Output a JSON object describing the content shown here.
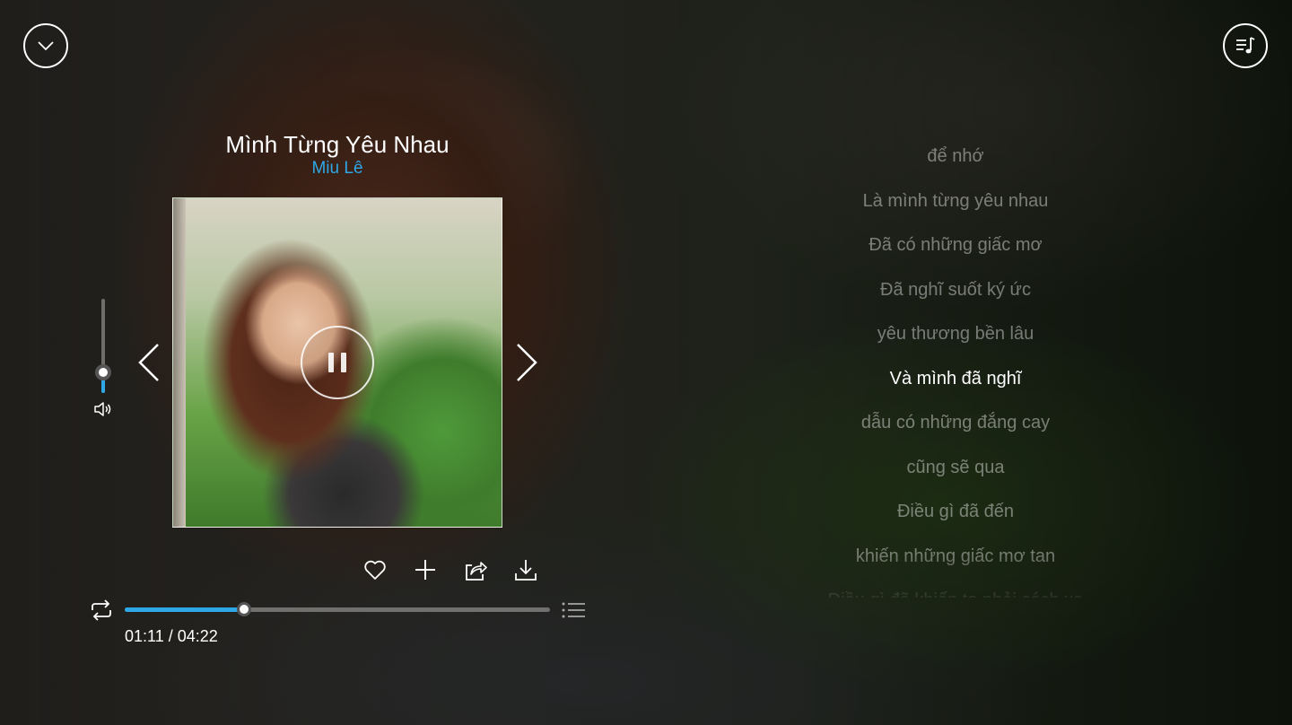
{
  "player": {
    "title": "Mình Từng Yêu Nhau",
    "artist": "Miu Lê",
    "time_display": "01:11 / 04:22",
    "progress": 0.28,
    "volume": 0.22,
    "state": "playing"
  },
  "icons": {
    "collapse": "chevron-down-icon",
    "playlist": "music-list-icon",
    "pause": "pause-icon",
    "prev": "chevron-left-icon",
    "next": "chevron-right-icon",
    "volume": "speaker-icon",
    "like": "heart-icon",
    "add": "plus-icon",
    "share": "share-icon",
    "download": "download-icon",
    "repeat": "repeat-icon",
    "queue": "queue-list-icon"
  },
  "colors": {
    "accent": "#2ea7e6",
    "text": "#ffffff",
    "lyric_inactive": "rgba(255,255,255,0.42)"
  },
  "lyrics": {
    "active_index": 5,
    "lines": [
      "để nhớ",
      "Là mình từng yêu nhau",
      "Đã có những giấc mơ",
      "Đã nghĩ suốt ký ức",
      "yêu thương bền lâu",
      "Và mình đã nghĩ",
      "dẫu có những đắng cay",
      "cũng sẽ qua",
      "Điều gì đã đến",
      "khiến những giấc mơ tan",
      "Điều gì đã khiến ta phải cách xa"
    ]
  }
}
